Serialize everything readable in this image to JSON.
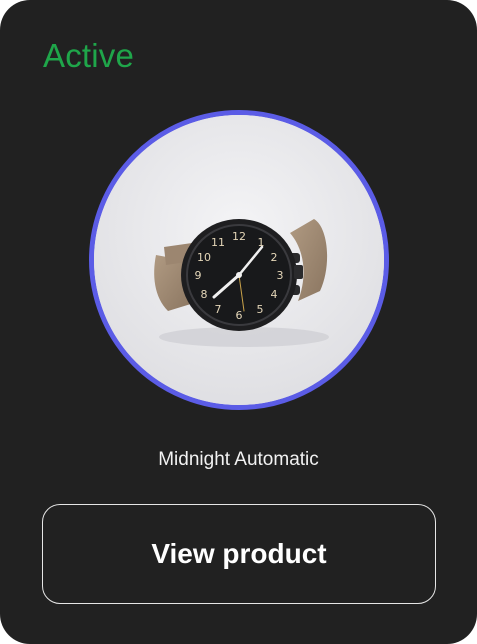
{
  "card": {
    "status_label": "Active",
    "status_color": "#1fa64a",
    "ring_color": "#5b5ce6",
    "product_name": "Midnight Automatic",
    "button_label": "View product",
    "image_icon": "wristwatch-photo"
  }
}
